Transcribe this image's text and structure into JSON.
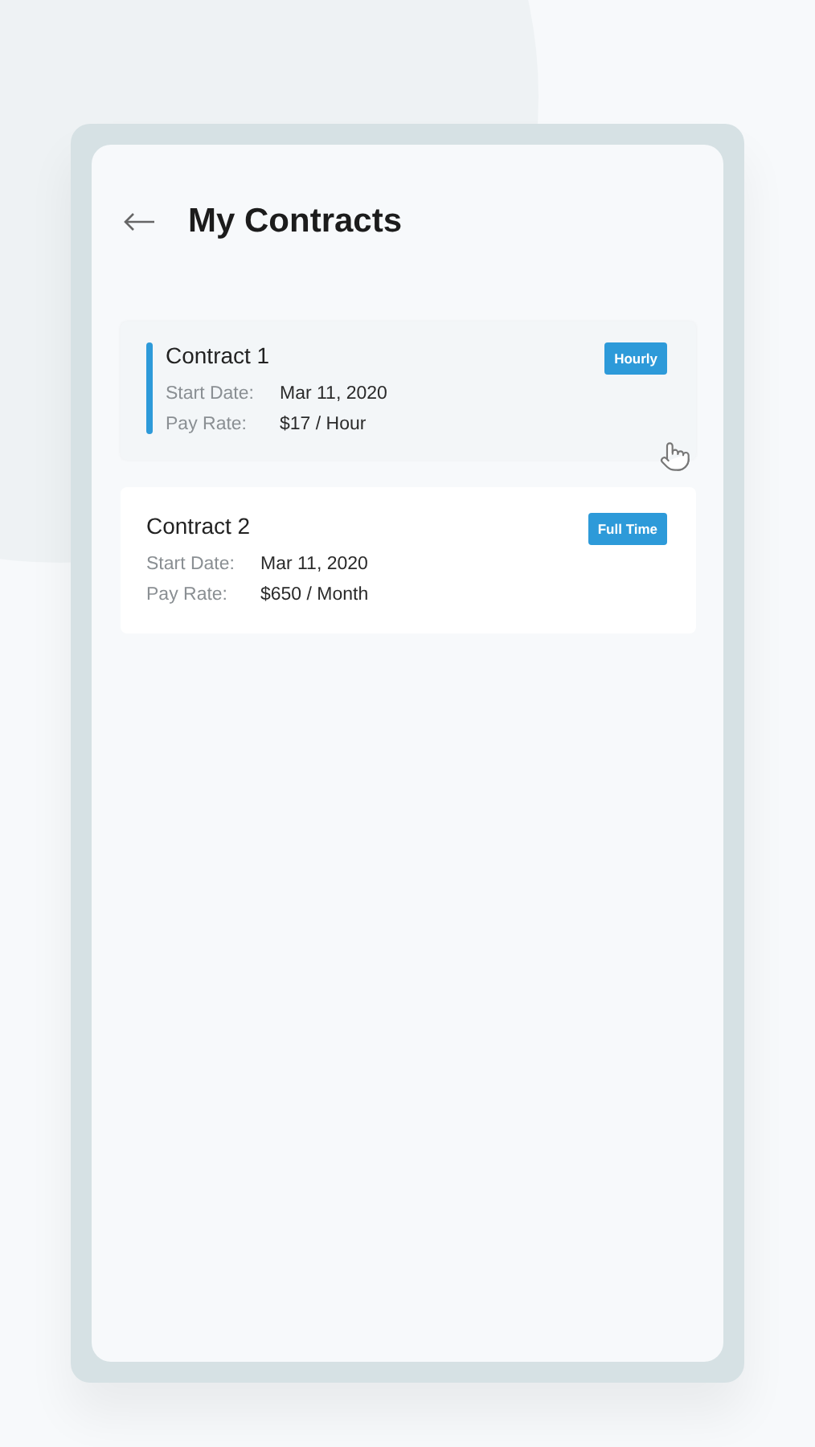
{
  "header": {
    "title": "My Contracts"
  },
  "contracts": [
    {
      "name": "Contract 1",
      "badge": "Hourly",
      "selected": true,
      "fields": [
        {
          "label": "Start Date:",
          "value": "Mar 11, 2020"
        },
        {
          "label": "Pay Rate:",
          "value": "$17 / Hour"
        }
      ]
    },
    {
      "name": "Contract 2",
      "badge": "Full Time",
      "selected": false,
      "fields": [
        {
          "label": "Start Date:",
          "value": "Mar 11, 2020"
        },
        {
          "label": "Pay Rate:",
          "value": "$650 / Month"
        }
      ]
    }
  ]
}
